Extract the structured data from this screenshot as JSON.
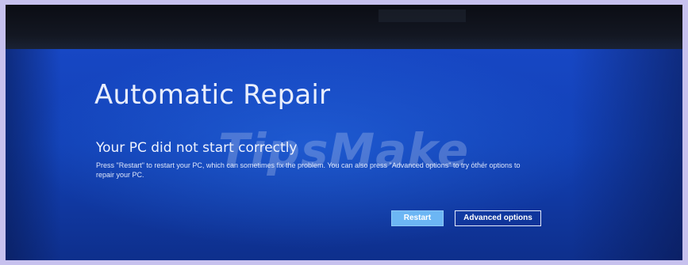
{
  "recovery": {
    "title": "Automatic Repair",
    "subtitle": "Your PC did not start correctly",
    "body": "Press \"Restart\" to restart your PC, which can sometimes fix the problem. You can also press \"Advanced options\" to try other options to repair your PC.",
    "restart_label": "Restart",
    "advanced_label": "Advanced options"
  },
  "watermark": {
    "text": "TipsMake",
    "suffix": "..."
  },
  "colors": {
    "screen_blue": "#1241b6",
    "restart_button": "#6cb6f4",
    "frame": "#c7c1ee",
    "text": "#e9eefc"
  }
}
